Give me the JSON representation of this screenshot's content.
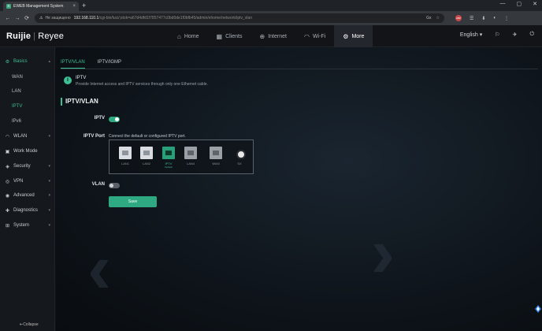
{
  "browser": {
    "tab_title": "EWEB Management System",
    "tab_close": "×",
    "new_tab": "+",
    "window_controls": [
      "—",
      "▢",
      "✕"
    ],
    "nav": [
      "←",
      "→",
      "⟳"
    ],
    "security_warning": "Не защищено",
    "host": "192.168.110.1",
    "path": "/cgi-bin/luci/;stok=a67d4dfd1f7857477c0bd0de1f0bfb45/admin/ehome/network/iptv_vlan",
    "omnibox_icons": [
      "Gx",
      "☆"
    ],
    "extensions": [
      "ABP",
      "☰",
      "⬇",
      "◐",
      "⋮"
    ]
  },
  "topbar": {
    "brand": "Ruijie",
    "brand_sep": "|",
    "brand_sub": "Reyee",
    "nav": [
      {
        "icon": "⌂",
        "label": "Home"
      },
      {
        "icon": "▦",
        "label": "Clients"
      },
      {
        "icon": "⊕",
        "label": "Internet"
      },
      {
        "icon": "◠",
        "label": "Wi-Fi"
      },
      {
        "icon": "⚙",
        "label": "More"
      }
    ],
    "language": "English",
    "lang_caret": "▾",
    "icons": [
      "⚐",
      "✈",
      "⏻"
    ]
  },
  "sidebar": {
    "basics": {
      "icon": "⚙",
      "label": "Basics",
      "caret": "▴"
    },
    "basics_items": [
      "WAN",
      "LAN",
      "IPTV",
      "IPv6"
    ],
    "groups": [
      {
        "icon": "◠",
        "label": "WLAN",
        "caret": "▾"
      },
      {
        "icon": "▣",
        "label": "Work Mode",
        "caret": ""
      },
      {
        "icon": "◈",
        "label": "Security",
        "caret": "▾"
      },
      {
        "icon": "◎",
        "label": "VPN",
        "caret": "▾"
      },
      {
        "icon": "◉",
        "label": "Advanced",
        "caret": "▾"
      },
      {
        "icon": "✚",
        "label": "Diagnostics",
        "caret": "▾"
      },
      {
        "icon": "⊞",
        "label": "System",
        "caret": "▾"
      }
    ],
    "collapse": "⇤Collapse"
  },
  "content": {
    "subtabs": [
      "IPTV/VLAN",
      "IPTV/IGMP"
    ],
    "info_icon": "i",
    "info_title": "IPTV",
    "info_text": "Provide Internet access and IPTV services through only one Ethernet cable.",
    "section_title": "IPTV/VLAN",
    "iptv_label": "IPTV",
    "iptv_enabled": true,
    "iptv_port_label": "IPTV Port",
    "iptv_port_hint": "Connect the default or configured IPTV port.",
    "ports": [
      {
        "label": "LAN1",
        "state": "free",
        "sub": ""
      },
      {
        "label": "LAN2",
        "state": "free",
        "sub": ""
      },
      {
        "label": "IPTV",
        "state": "iptv",
        "sub": "Default"
      },
      {
        "label": "LAN4",
        "state": "used",
        "sub": ""
      },
      {
        "label": "WAN",
        "state": "used",
        "sub": ""
      },
      {
        "label": "SX",
        "state": "sfp",
        "sub": ""
      }
    ],
    "vlan_label": "VLAN",
    "vlan_enabled": false,
    "save_label": "Save"
  },
  "colors": {
    "accent": "#2fa982",
    "accent_text": "#3fbf95"
  }
}
